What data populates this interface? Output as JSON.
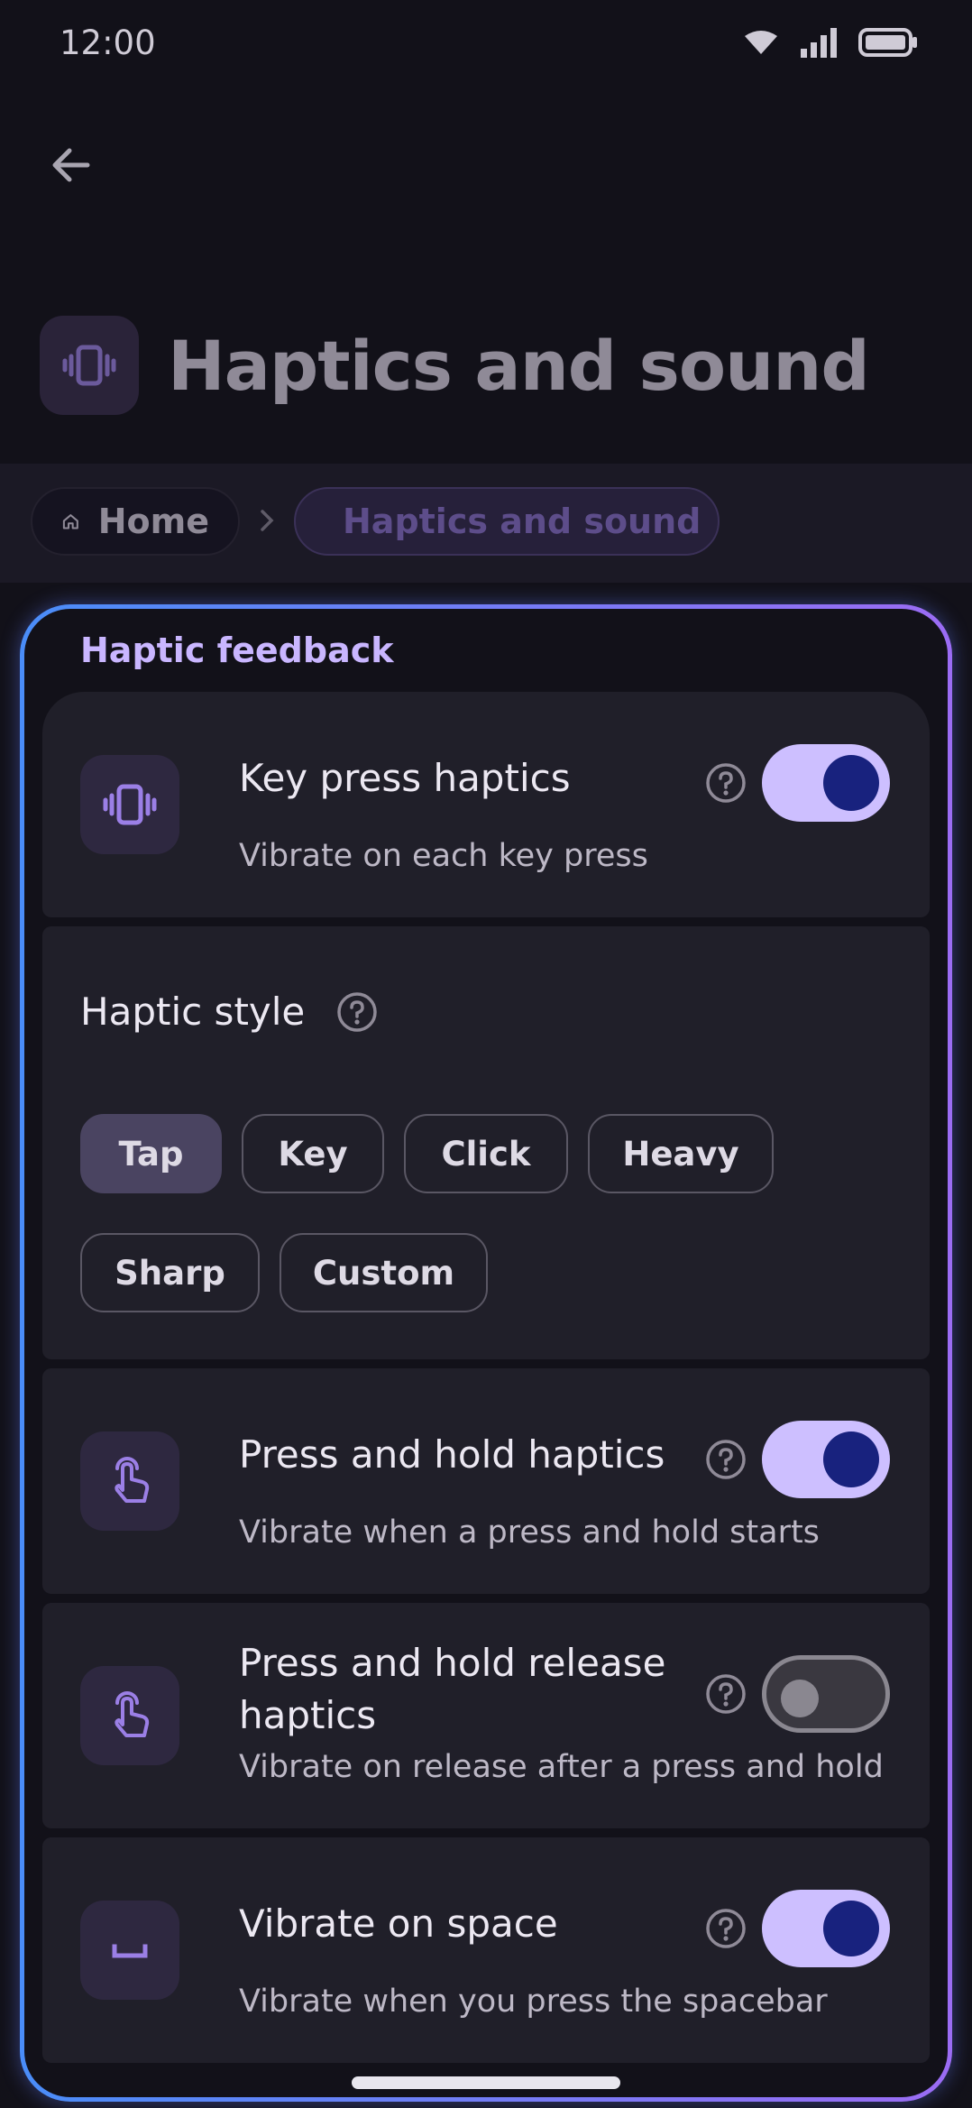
{
  "status_bar": {
    "time": "12:00",
    "icons": [
      "wifi-icon",
      "signal-icon",
      "battery-icon"
    ]
  },
  "header": {
    "back_icon": "arrow-left-icon",
    "title": "Haptics and sound",
    "title_icon": "vibrate-icon"
  },
  "breadcrumb": [
    {
      "label": "Home",
      "icon": "home-icon"
    },
    {
      "label": "Haptics and sound",
      "icon": "vibrate-icon"
    }
  ],
  "section": {
    "title": "Haptic feedback"
  },
  "settings": {
    "key_press": {
      "title": "Key press haptics",
      "subtitle": "Vibrate on each key press",
      "enabled": true,
      "icon": "vibrate-icon"
    },
    "haptic_style": {
      "title": "Haptic style",
      "options": [
        "Tap",
        "Key",
        "Click",
        "Heavy",
        "Sharp",
        "Custom"
      ],
      "selected": "Tap"
    },
    "press_hold": {
      "title": "Press and hold haptics",
      "subtitle": "Vibrate when a press and hold starts",
      "enabled": true,
      "icon": "touch-icon"
    },
    "press_hold_release": {
      "title_line1": "Press and hold release",
      "title_line2": "haptics",
      "subtitle": "Vibrate on release after a press and hold",
      "enabled": false,
      "icon": "touch-icon"
    },
    "vibrate_space": {
      "title": "Vibrate on space",
      "subtitle": "Vibrate when you press the spacebar",
      "enabled": true,
      "icon": "spacebar-icon"
    }
  },
  "colors": {
    "accent": "#cdbfff",
    "knob_on": "#18227e",
    "border_start": "#4a8df8",
    "border_end": "#9b6cf4",
    "background": "#121119",
    "card": "#201f29"
  }
}
